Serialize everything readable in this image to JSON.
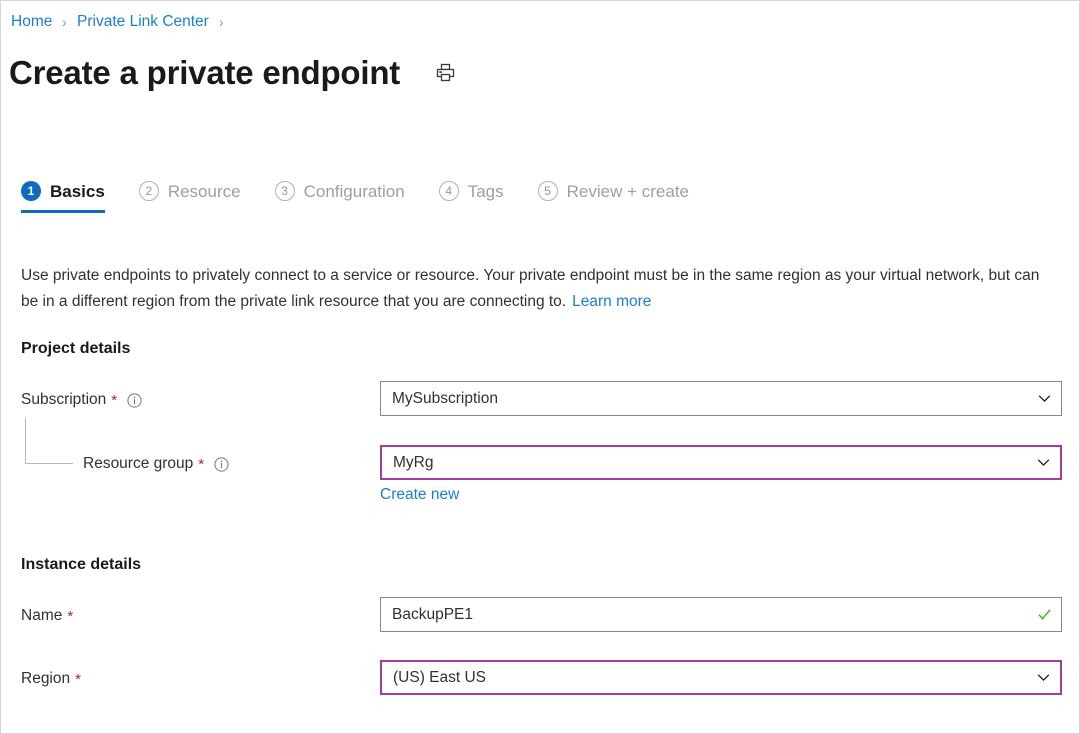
{
  "breadcrumb": {
    "items": [
      {
        "label": "Home"
      },
      {
        "label": "Private Link Center"
      }
    ],
    "separator": "›"
  },
  "header": {
    "title": "Create a private endpoint",
    "print_icon": "printer-icon"
  },
  "tabs": [
    {
      "number": "1",
      "label": "Basics",
      "active": true
    },
    {
      "number": "2",
      "label": "Resource",
      "active": false
    },
    {
      "number": "3",
      "label": "Configuration",
      "active": false
    },
    {
      "number": "4",
      "label": "Tags",
      "active": false
    },
    {
      "number": "5",
      "label": "Review + create",
      "active": false
    }
  ],
  "description": {
    "text": "Use private endpoints to privately connect to a service or resource. Your private endpoint must be in the same region as your virtual network, but can be in a different region from the private link resource that you are connecting to.",
    "link_label": "Learn more"
  },
  "sections": {
    "project_details": {
      "heading": "Project details",
      "subscription": {
        "label": "Subscription",
        "required_marker": "*",
        "info_icon": "info-icon",
        "value": "MySubscription",
        "affix_icon": "chevron-down-icon",
        "focused": false
      },
      "resource_group": {
        "label": "Resource group",
        "required_marker": "*",
        "info_icon": "info-icon",
        "value": "MyRg",
        "affix_icon": "chevron-down-icon",
        "focused": true,
        "create_new_label": "Create new"
      }
    },
    "instance_details": {
      "heading": "Instance details",
      "name": {
        "label": "Name",
        "required_marker": "*",
        "value": "BackupPE1",
        "affix_icon": "checkmark-icon",
        "focused": false
      },
      "region": {
        "label": "Region",
        "required_marker": "*",
        "value": "(US) East US",
        "affix_icon": "chevron-down-icon",
        "focused": true
      }
    }
  },
  "colors": {
    "link": "#1a7fd4",
    "accent": "#0f6cbd",
    "focus_border": "#a33ea1",
    "required": "#a4262c",
    "valid_check": "#4caf28",
    "border": "#8a8886"
  }
}
